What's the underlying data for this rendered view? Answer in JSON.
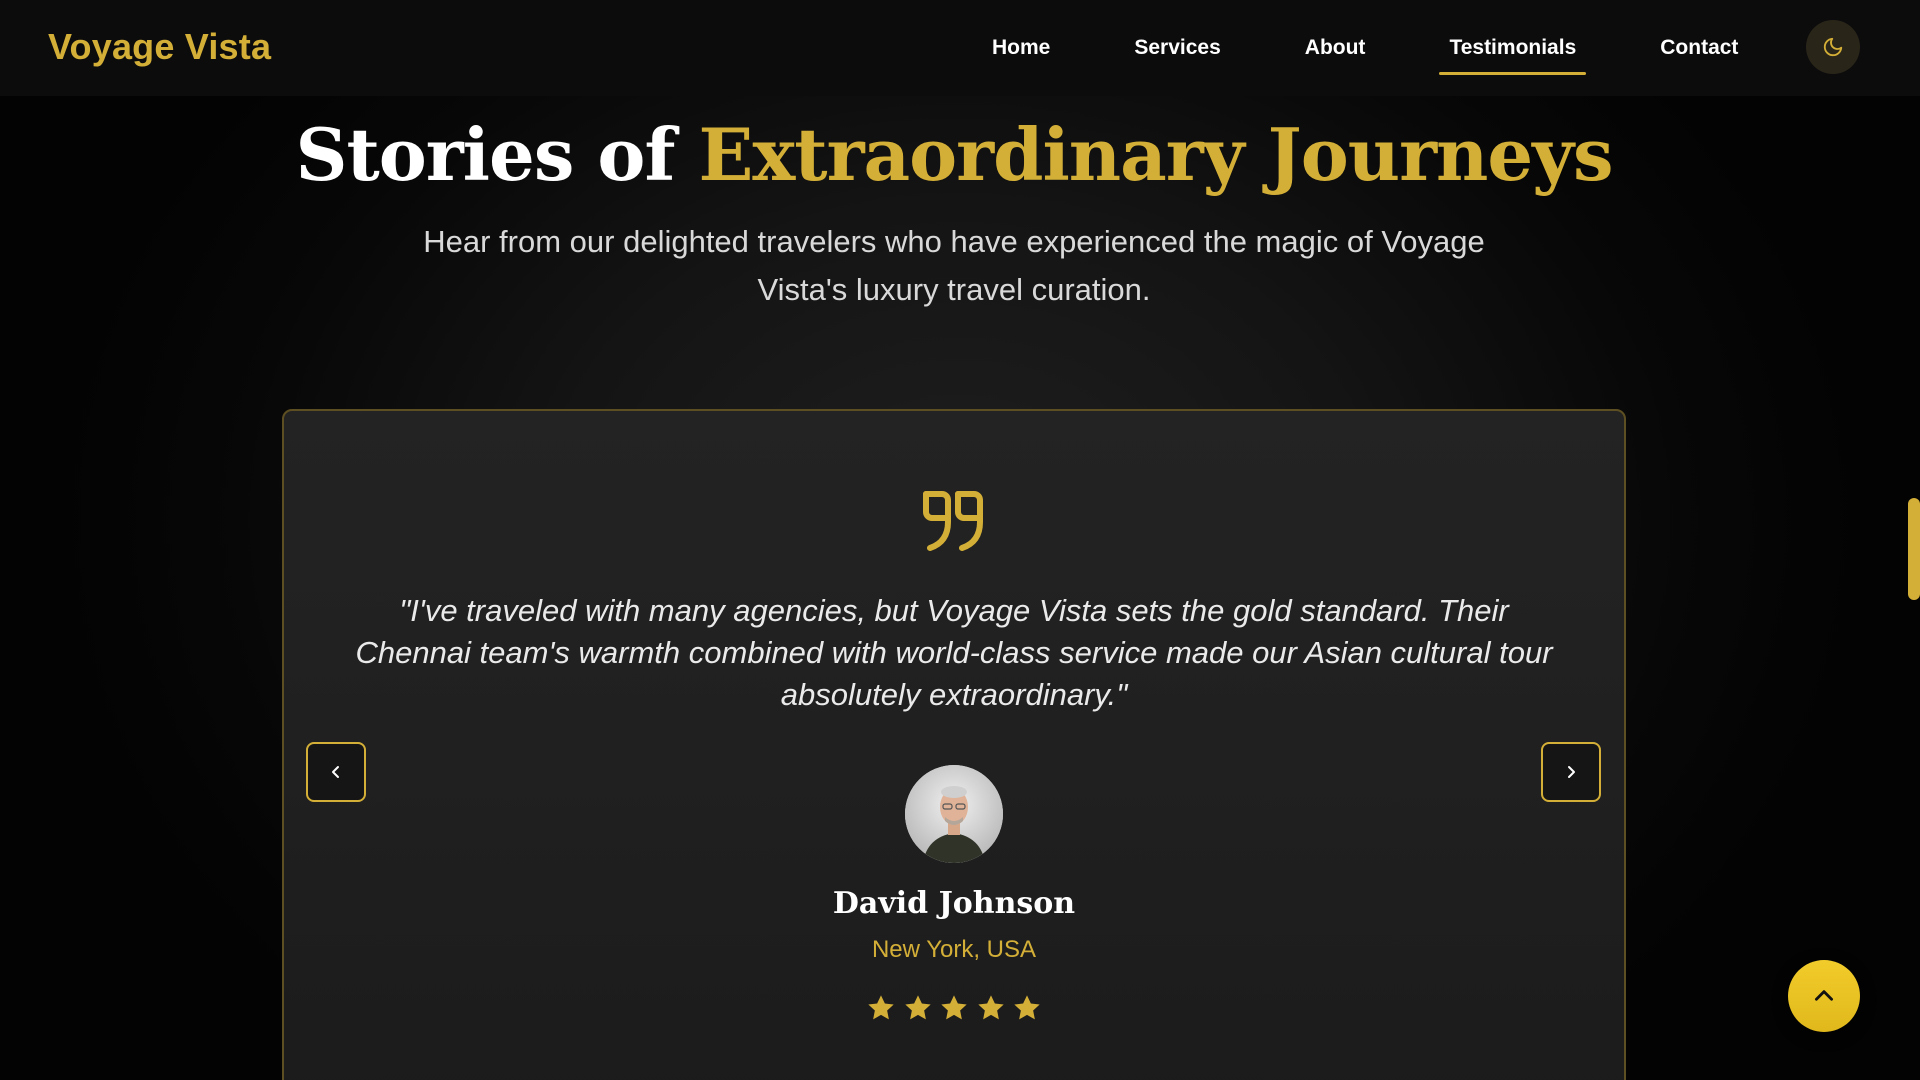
{
  "brand": {
    "name": "Voyage Vista"
  },
  "nav": {
    "items": [
      {
        "label": "Home"
      },
      {
        "label": "Services"
      },
      {
        "label": "About"
      },
      {
        "label": "Testimonials",
        "active": true
      },
      {
        "label": "Contact"
      }
    ],
    "theme_toggle_icon": "moon-icon"
  },
  "section": {
    "title_prefix": "Stories of",
    "title_accent": "Extraordinary Journeys",
    "subtitle": "Hear from our delighted travelers who have experienced the magic of Voyage Vista's luxury travel curation."
  },
  "testimonial": {
    "quote": "\"I've traveled with many agencies, but Voyage Vista sets the gold standard. Their Chennai team's warmth combined with world-class service made our Asian cultural tour absolutely extraordinary.\"",
    "author": "David Johnson",
    "location": "New York, USA",
    "rating": 5,
    "rating_max": 5
  },
  "icons": {
    "quote": "quote-icon",
    "prev": "chevron-left-icon",
    "next": "chevron-right-icon",
    "back_to_top": "chevron-up-icon",
    "star": "star-icon"
  },
  "colors": {
    "accent": "#d4af37",
    "background": "#050505",
    "card": "#202020",
    "back_to_top": "#f2cc2a"
  }
}
